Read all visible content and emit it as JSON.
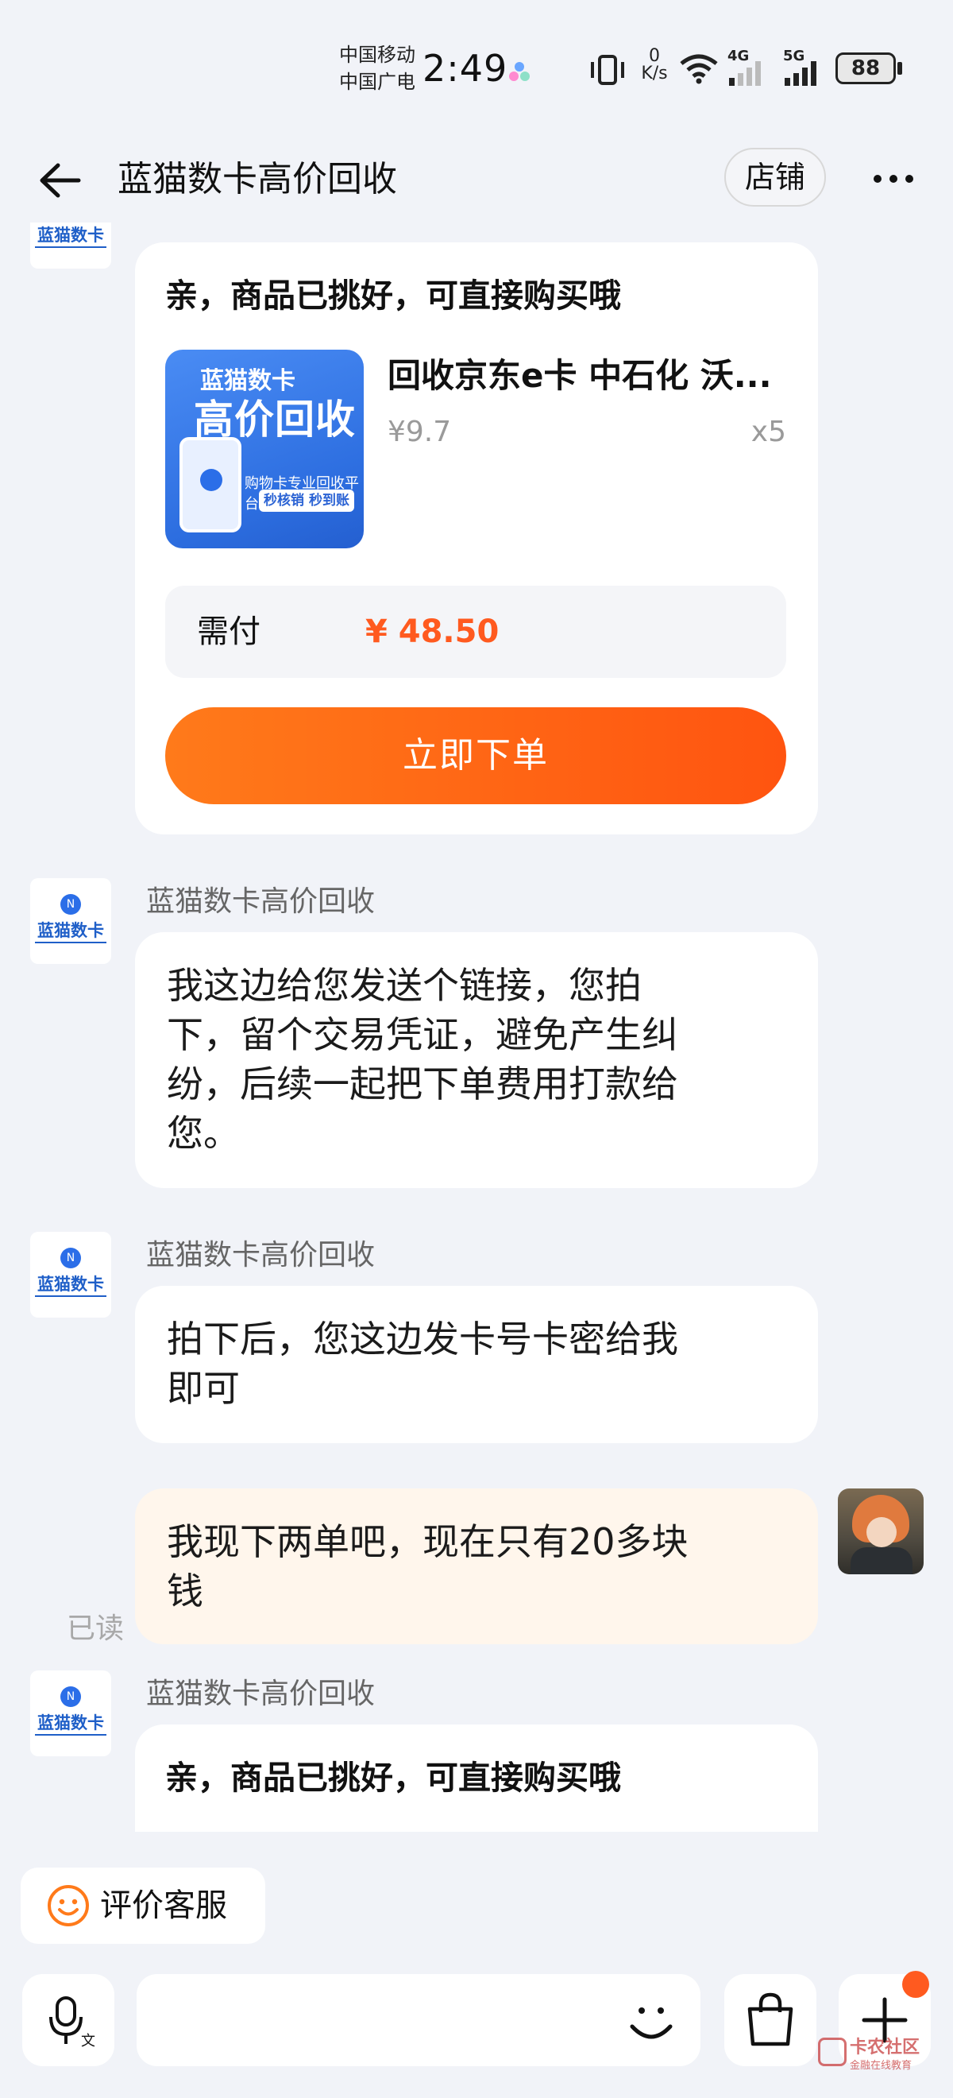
{
  "status_bar": {
    "carrier_1": "中国移动",
    "carrier_2": "中国广电",
    "time": "2:49",
    "net_speed_value": "0",
    "net_speed_unit": "K/s",
    "sim1_type": "4G",
    "sim2_type": "5G",
    "battery": "88"
  },
  "header": {
    "title": "蓝猫数卡高价回收",
    "shop_button": "店铺"
  },
  "shop_avatar_text": "蓝猫数卡",
  "product_card": {
    "heading": "亲，商品已挑好，可直接购买哦",
    "thumb_line1": "蓝猫数卡",
    "thumb_line2": "高价回收",
    "thumb_line3": "购物卡专业回收平台",
    "thumb_line4": "秒核销 秒到账",
    "product_title": "回收京东e卡 中石化 沃...",
    "unit_price": "¥9.7",
    "quantity": "x5",
    "pay_label": "需付",
    "pay_amount": "¥ 48.50",
    "order_button": "立即下单"
  },
  "messages": [
    {
      "sender": "蓝猫数卡高价回收",
      "lines": [
        "我这边给您发送个链接，您拍",
        "下，留个交易凭证，避免产生纠",
        "纷，后续一起把下单费用打款给",
        "您。"
      ]
    },
    {
      "sender": "蓝猫数卡高价回收",
      "lines": [
        "拍下后，您这边发卡号卡密给我",
        "即可"
      ]
    },
    {
      "sender": "me",
      "lines": [
        "我现下两单吧，现在只有20多块",
        "钱"
      ],
      "read_status": "已读"
    },
    {
      "sender": "蓝猫数卡高价回收",
      "heading": "亲，商品已挑好，可直接购买哦"
    }
  ],
  "bottom": {
    "rate_button": "评价客服",
    "watermark_text": "卡农社区",
    "watermark_sub": "金融在线教育"
  },
  "colors": {
    "accent_orange": "#ff5a1f",
    "brand_blue": "#2b6ee8",
    "background": "#f1f3f8"
  },
  "icons": [
    "back-arrow-icon",
    "more-icon",
    "smile-icon",
    "mic-icon",
    "emoji-icon",
    "bag-icon",
    "plus-icon",
    "vibrate-icon",
    "wifi-icon",
    "signal-icon",
    "battery-icon"
  ]
}
